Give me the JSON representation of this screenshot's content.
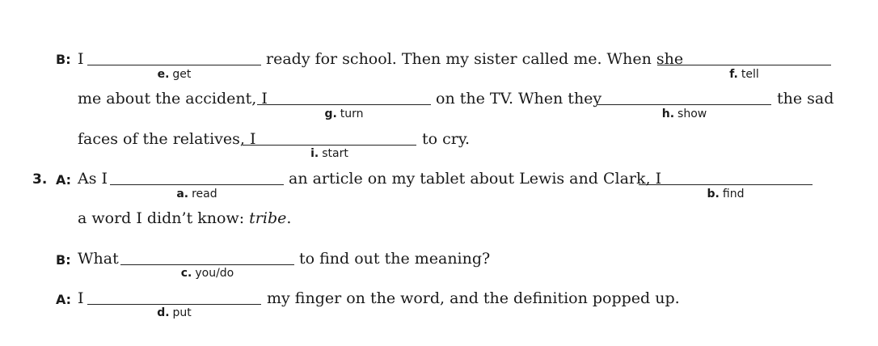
{
  "exercise": {
    "item2": {
      "speaker_b_label": "B:",
      "line1": {
        "pre": "I",
        "mid": "ready for school. Then my sister called me. When she"
      },
      "line2": {
        "pre": "me about the accident, I",
        "mid": "on the TV. When they",
        "post": "the sad"
      },
      "line3": {
        "pre": "faces of the relatives, I",
        "post": "to cry."
      },
      "hints": {
        "e": {
          "letter": "e.",
          "verb": "get"
        },
        "f": {
          "letter": "f.",
          "verb": "tell"
        },
        "g": {
          "letter": "g.",
          "verb": "turn"
        },
        "h": {
          "letter": "h.",
          "verb": "show"
        },
        "i": {
          "letter": "i.",
          "verb": "start"
        }
      }
    },
    "item3": {
      "number": "3.",
      "speaker_a_label": "A:",
      "line1": {
        "pre": "As I",
        "mid": "an article on my tablet about Lewis and Clark, I"
      },
      "line2": {
        "pre": "a word I didn’t know: ",
        "italic": "tribe",
        "post": "."
      },
      "speaker_b_label": "B:",
      "line3": {
        "pre": "What",
        "post": "to find out the meaning?"
      },
      "speaker_a2_label": "A:",
      "line4": {
        "pre": "I",
        "post": "my finger on the word, and the definition popped up."
      },
      "hints": {
        "a": {
          "letter": "a.",
          "verb": "read"
        },
        "b": {
          "letter": "b.",
          "verb": "find"
        },
        "c": {
          "letter": "c.",
          "verb": "you/do"
        },
        "d": {
          "letter": "d.",
          "verb": "put"
        }
      }
    }
  }
}
